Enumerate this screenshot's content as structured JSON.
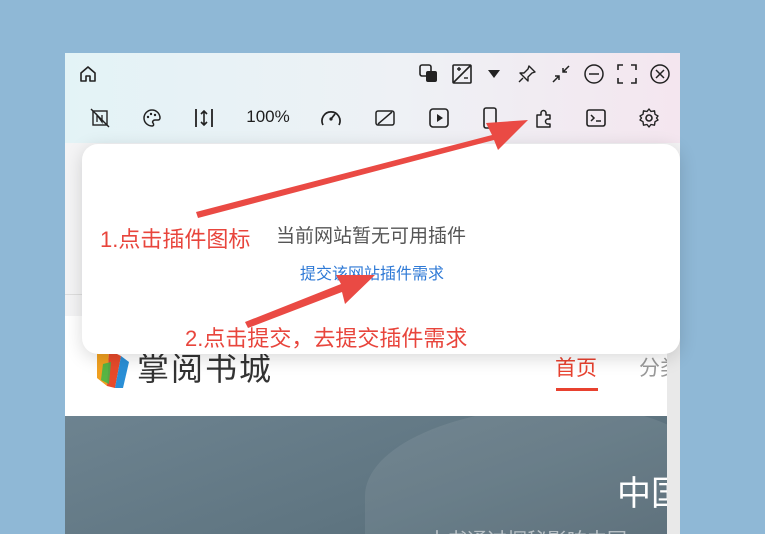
{
  "toolbar": {
    "zoom_value": "100%",
    "row1_icons": [
      "home-icon",
      "switch-windows-icon",
      "image-edit-icon",
      "dropdown-caret-icon",
      "pin-icon",
      "shrink-icon",
      "minimize-icon",
      "fullscreen-icon",
      "close-icon"
    ],
    "row2_icons": [
      "no-image-icon",
      "palette-icon",
      "vertical-resize-icon",
      "speed-dial-icon",
      "ad-block-icon",
      "play-icon",
      "phone-icon",
      "extension-icon",
      "terminal-icon",
      "settings-icon"
    ]
  },
  "popup": {
    "message": "当前网站暂无可用插件",
    "link": "提交该网站插件需求"
  },
  "annotations": {
    "step1": "1.点击插件图标",
    "step2": "2.点击提交，去提交插件需求",
    "color": "#e8453c"
  },
  "site": {
    "logo_text": "掌阅书城",
    "nav_home": "首页",
    "nav_category": "分类",
    "hero_title": "中国",
    "hero_subtitle": "本书通过探秘影响中国"
  },
  "colors": {
    "accent": "#e8412f",
    "link": "#2f7ad6",
    "background": "#8fb8d6"
  }
}
